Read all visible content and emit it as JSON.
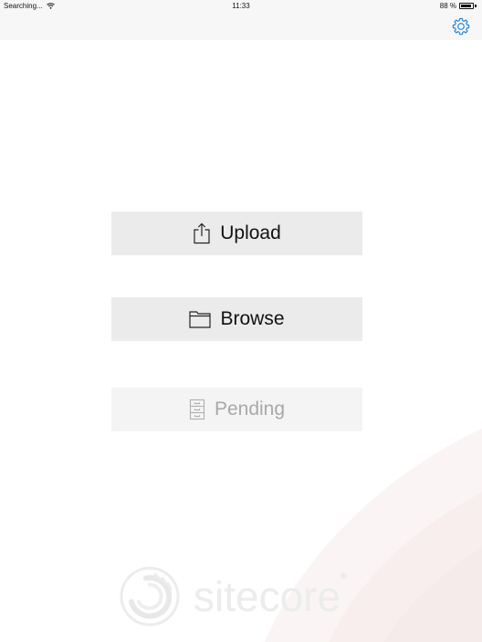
{
  "status_bar": {
    "carrier": "Searching...",
    "time": "11:33",
    "battery_percent": "88 %",
    "battery_level": 0.88
  },
  "nav": {
    "settings_icon": "gear-icon"
  },
  "buttons": {
    "upload": {
      "label": "Upload",
      "icon": "share-upload-icon"
    },
    "browse": {
      "label": "Browse",
      "icon": "folder-icon"
    },
    "pending": {
      "label": "Pending",
      "icon": "file-cabinet-icon",
      "disabled": true
    }
  },
  "branding": {
    "logo_text": "sitecore",
    "registered_mark": "®"
  },
  "colors": {
    "accent": "#1a7fd4",
    "button_bg": "#ebebeb",
    "button_disabled_bg": "#f4f4f4",
    "disabled_text": "#a8a8a8"
  }
}
